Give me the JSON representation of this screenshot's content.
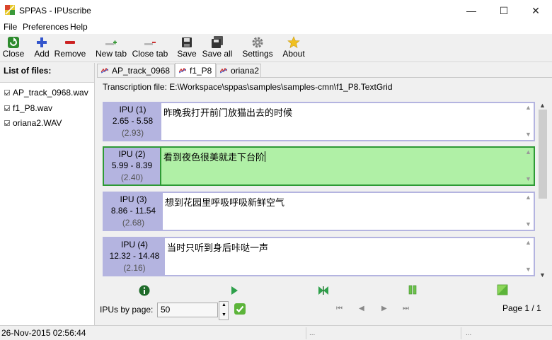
{
  "window": {
    "title": "SPPAS - IPUscribe",
    "minimize": "—",
    "maximize": "☐",
    "close": "✕"
  },
  "menu": [
    "File",
    "Preferences",
    "Help"
  ],
  "toolbar": [
    {
      "label": "Close",
      "icon": "close-file-icon",
      "color": "#2e8b2e"
    },
    {
      "label": "Add",
      "icon": "plus-icon",
      "color": "#3355cc"
    },
    {
      "label": "Remove",
      "icon": "minus-icon",
      "color": "#cc2222"
    },
    {
      "label": "New tab",
      "icon": "new-tab-icon",
      "color": "#3a9a3a"
    },
    {
      "label": "Close tab",
      "icon": "close-tab-icon",
      "color": "#cc3333"
    },
    {
      "label": "Save",
      "icon": "floppy-icon",
      "color": "#333333"
    },
    {
      "label": "Save all",
      "icon": "floppy-multiple-icon",
      "color": "#333333"
    },
    {
      "label": "Settings",
      "icon": "gear-icon",
      "color": "#777777"
    },
    {
      "label": "About",
      "icon": "star-icon",
      "color": "#f0c020"
    }
  ],
  "files": {
    "header": "List of files:",
    "items": [
      "AP_track_0968.wav",
      "f1_P8.wav",
      "oriana2.WAV"
    ]
  },
  "tabs": [
    "AP_track_0968",
    "f1_P8",
    "oriana2"
  ],
  "transcription": {
    "label": "Transcription file: E:\\Workspace\\sppas\\samples\\samples-cmn\\f1_P8.TextGrid"
  },
  "ipus": [
    {
      "name": "IPU (1)",
      "range": "2.65 -   5.58",
      "duration": "(2.93)",
      "text": "昨晚我打开前门放猫出去的时候",
      "active": false
    },
    {
      "name": "IPU (2)",
      "range": "5.99 -   8.39",
      "duration": "(2.40)",
      "text": "看到夜色很美就走下台阶",
      "active": true
    },
    {
      "name": "IPU (3)",
      "range": "8.86 -  11.54",
      "duration": "(2.68)",
      "text": "想到花园里呼吸呼吸新鲜空气",
      "active": false
    },
    {
      "name": "IPU (4)",
      "range": "12.32 -  14.48",
      "duration": "(2.16)",
      "text": "当时只听到身后咔哒一声",
      "active": false
    }
  ],
  "controls": {
    "ipus_by_page_label": "IPUs by page:",
    "ipus_by_page_value": "50",
    "page_label": "Page 1 / 1"
  },
  "status": {
    "datetime": "26-Nov-2015 02:56:44",
    "dots1": "...",
    "dots2": "..."
  },
  "colors": {
    "ipu_meta_bg": "#b4b4e0",
    "ipu_active_border": "#2e9a35",
    "ipu_active_bg": "#b0f0a6"
  }
}
